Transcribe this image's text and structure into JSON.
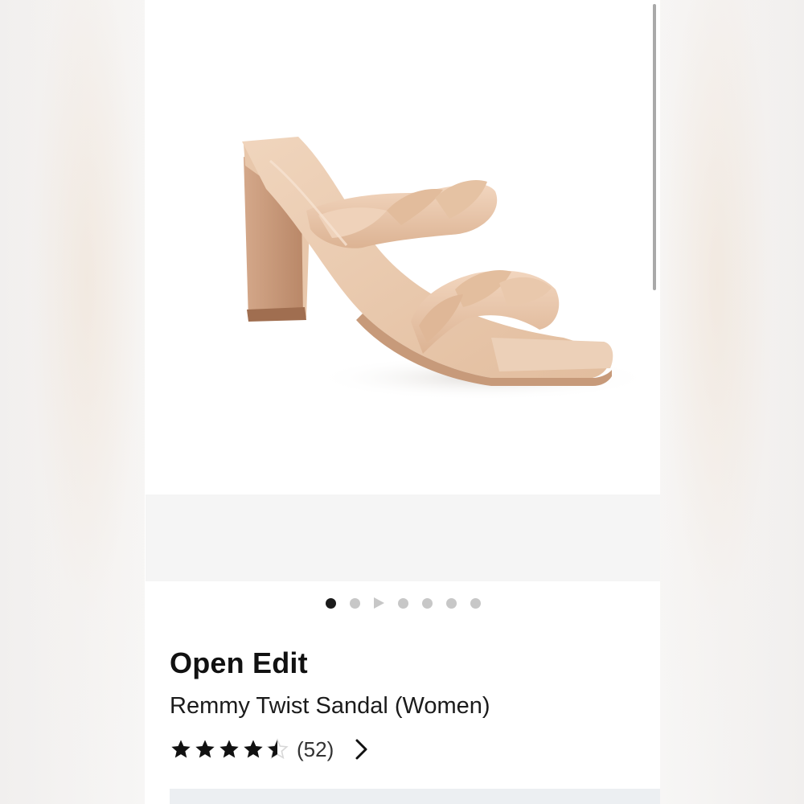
{
  "brand": "Open Edit",
  "product_name": "Remmy Twist Sandal (Women)",
  "rating": {
    "value": 4.5,
    "max": 5,
    "review_count": "(52)"
  },
  "carousel": {
    "total_slots": 7,
    "active_index": 0,
    "video_slot_index": 2
  },
  "icons": {
    "stars": "star-icon",
    "chevron": "chevron-right-icon",
    "video": "play-icon"
  },
  "colors": {
    "sandal": "#e9c6a9",
    "active_dot": "#1b1b1b",
    "inactive_dot": "#c7c7c7",
    "star": "#111111"
  }
}
